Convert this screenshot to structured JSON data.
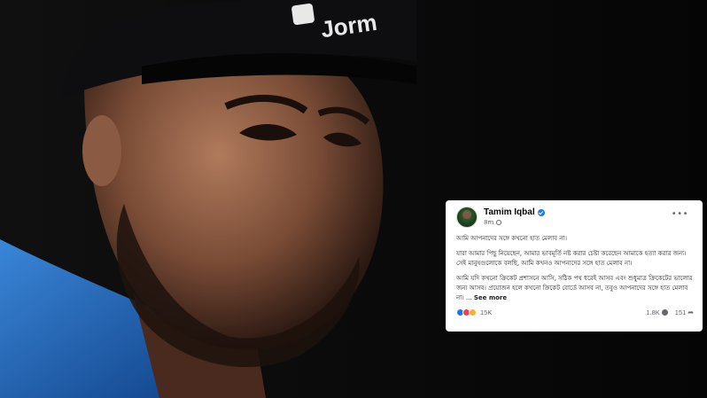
{
  "post": {
    "author": "Tamim Iqbal",
    "time": "8m",
    "more_icon": "ellipsis-icon",
    "paragraphs": [
      "আমি আপনাদের সঙ্গে কখনো হাত মেলাব না।",
      "যারা আমার পিছু নিয়েছেন, আমার ভাবমূর্তি নষ্ট করার চেষ্টা করেছেন আমাকে হত্যা করার জন্য। সেই মানুষগুলোকে বলছি, আমি কখনও আপনাদের সঙ্গে হাত মেলাব না।",
      "আমি যদি কখনো ক্রিকেট প্রশাসনে আসি, সঠিক পথ ধরেই আসব এবং শুধুমাত্র ক্রিকেটের ভালোর জন্য আসব। প্রয়োজন হলে কখনো ক্রিকেট বোর্ডে আসব না, তবুও আপনাদের সঙ্গে হাত মেলাব না। ..."
    ],
    "see_more": "See more",
    "reactions_count": "15K",
    "comments_count": "1.8K",
    "shares_count": "151"
  },
  "colors": {
    "verified_blue": "#1877f2",
    "card_bg": "#ffffff",
    "muted_text": "#65676b",
    "jersey_blue": "#1a5fb4"
  },
  "photo": {
    "cap_logo_text": "Jorm"
  }
}
